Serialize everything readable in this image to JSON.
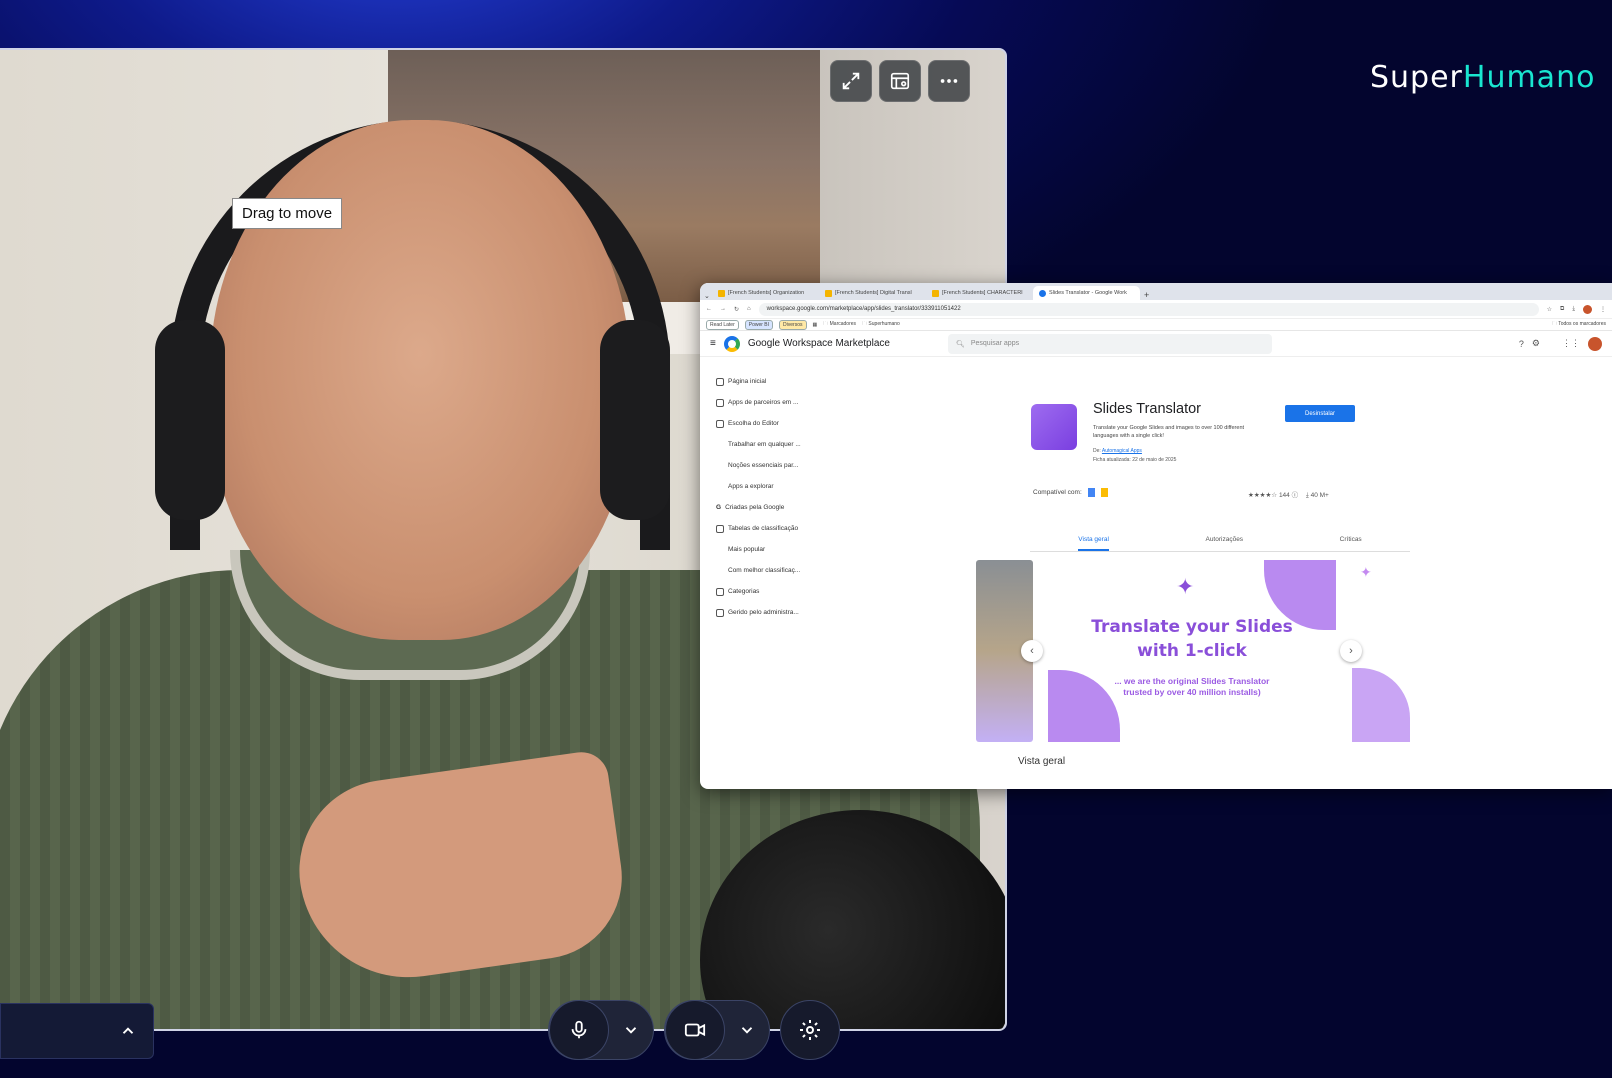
{
  "tooltip": "Drag to move",
  "brand": {
    "part1": "Super",
    "part2": "Humano"
  },
  "browser": {
    "tabs": [
      "[French Students] Organization",
      "[French Students] Digital Transl",
      "[French Students] CHARACTERI",
      "Slides Translator - Google Work"
    ],
    "url": "workspace.google.com/marketplace/app/slides_translator/333911051422",
    "bookmarks": [
      "Read Later",
      "Power BI",
      "Diversos",
      "Marcadores",
      "Superhumano",
      "Todos os marcadores"
    ],
    "app_title": "Google Workspace Marketplace",
    "search_placeholder": "Pesquisar apps"
  },
  "sidebar": {
    "items": [
      "Página inicial",
      "Apps de parceiros em ...",
      "Escolha do Editor",
      "Trabalhar em qualquer ...",
      "Noções essenciais par...",
      "Apps a explorar",
      "Criadas pela Google",
      "Tabelas de classificação",
      "Mais popular",
      "Com melhor classificaç...",
      "Categorias",
      "Gerido pelo administra..."
    ]
  },
  "listing": {
    "title": "Slides Translator",
    "description": "Translate your Google Slides and images to over 100 different languages with a single click!",
    "by_label": "De:",
    "developer": "Automagical Apps",
    "updated": "Ficha atualizada: 22 de maio de 2025",
    "uninstall": "Desinstalar",
    "compatible": "Compatível com:",
    "rating": "★★★★☆ 144 ⓘ",
    "installs": "⤓ 40 M+",
    "tabs": [
      "Vista geral",
      "Autorizações",
      "Críticas"
    ],
    "slide_title_1": "Translate your Slides",
    "slide_title_2": "with 1-click",
    "slide_sub_1": "... we are the original Slides Translator",
    "slide_sub_2": "trusted by over 40 million installs)",
    "section_heading": "Vista geral"
  },
  "colors": {
    "accent": "#1a73e8",
    "brand_teal": "#19e6d0",
    "slide_purple": "#8a4fd9"
  }
}
